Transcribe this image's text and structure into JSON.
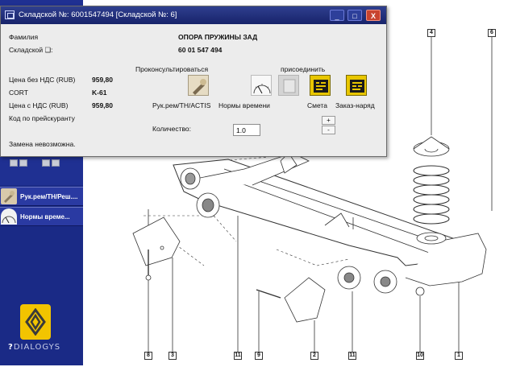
{
  "dialog": {
    "title": "Складской №: 6001547494 [Складской №: 6]",
    "close_glyph": "X",
    "min_glyph": "_",
    "max_glyph": "□",
    "family_label": "Фамилия",
    "family_value": "ОПОРА ПРУЖИНЫ ЗАД",
    "part_no_label": "Складской ❏:",
    "part_no_value": "60 01 547 494",
    "price_excl_label": "Цена без НДС (RUB)",
    "price_excl_value": "959,80",
    "cort_label": "CORT",
    "cort_value": "K-61",
    "price_incl_label": "Цена с НДС (RUB)",
    "price_incl_value": "959,80",
    "price_code_label": "Код по прейскуранту",
    "consult_header": "Проконсультироваться",
    "attach_header": "присоединить",
    "btn_repair_manual": "Рук.рем/TH/ACTIS",
    "btn_time_norms": "Нормы времени",
    "btn_estimate": "Смета",
    "btn_work_order": "Заказ-наряд",
    "quantity_label": "Количество:",
    "quantity_value": "1.0",
    "spin_up": "+",
    "spin_down": "-",
    "status_text": "Замена невозможна."
  },
  "sidebar": {
    "item_repair": "Рук.рем/ТН/Реш....",
    "item_norms": "Нормы време..."
  },
  "logos": {
    "dialogys": "DIALOGYS"
  },
  "diagram": {
    "callouts": [
      "4",
      "6",
      "8",
      "3",
      "11",
      "9",
      "2",
      "11",
      "10",
      "1"
    ]
  },
  "colors": {
    "titlebar": "#1f2d7a",
    "sidebar": "#1f3092",
    "logo_yellow": "#f2c400"
  }
}
